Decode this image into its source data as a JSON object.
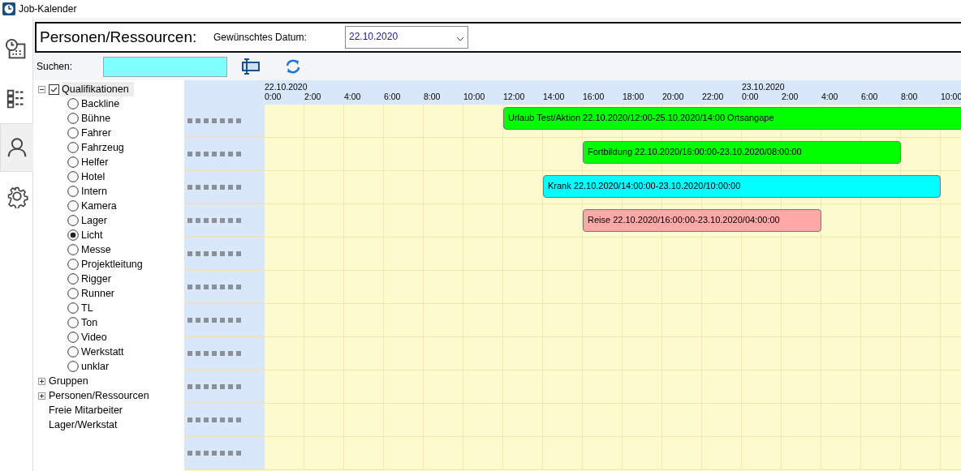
{
  "window": {
    "title": "Job-Kalender"
  },
  "sidebar": {
    "items": [
      {
        "kind": "calendar",
        "selected": false
      },
      {
        "kind": "list",
        "selected": false
      },
      {
        "kind": "person",
        "selected": true
      },
      {
        "kind": "settings",
        "selected": false
      }
    ]
  },
  "header": {
    "title": "Personen/Ressourcen:",
    "date_label": "Gewünschtes Datum:",
    "date_value": "22.10.2020"
  },
  "search": {
    "label": "Suchen:"
  },
  "tree": [
    {
      "label": "Qualifikationen",
      "kind": "checkbox",
      "checked": true,
      "expanded": true,
      "selected": true,
      "children": [
        {
          "label": "Backline",
          "selected": false
        },
        {
          "label": "Bühne",
          "selected": false
        },
        {
          "label": "Fahrer",
          "selected": false
        },
        {
          "label": "Fahrzeug",
          "selected": false
        },
        {
          "label": "Helfer",
          "selected": false
        },
        {
          "label": "Hotel",
          "selected": false
        },
        {
          "label": "Intern",
          "selected": false
        },
        {
          "label": "Kamera",
          "selected": false
        },
        {
          "label": "Lager",
          "selected": false
        },
        {
          "label": "Licht",
          "selected": true
        },
        {
          "label": "Messe",
          "selected": false
        },
        {
          "label": "Projektleitung",
          "selected": false
        },
        {
          "label": "Rigger",
          "selected": false
        },
        {
          "label": "Runner",
          "selected": false
        },
        {
          "label": "TL",
          "selected": false
        },
        {
          "label": "Ton",
          "selected": false
        },
        {
          "label": "Video",
          "selected": false
        },
        {
          "label": "Werkstatt",
          "selected": false
        },
        {
          "label": "unklar",
          "selected": false
        }
      ]
    },
    {
      "label": "Gruppen",
      "kind": "node",
      "expanded": false,
      "selected": false
    },
    {
      "label": "Personen/Ressourcen",
      "kind": "node",
      "expanded": false,
      "selected": false
    },
    {
      "label": "Freie Mitarbeiter",
      "kind": "leaf",
      "selected": false
    },
    {
      "label": "Lager/Werkstat",
      "kind": "leaf",
      "selected": false
    }
  ],
  "timeline": {
    "days": [
      "22.10.2020",
      "23.10.2020"
    ],
    "hours": [
      "0:00",
      "2:00",
      "4:00",
      "6:00",
      "8:00",
      "10:00",
      "12:00",
      "14:00",
      "16:00",
      "18:00",
      "20:00",
      "22:00",
      "0:00",
      "2:00",
      "4:00",
      "6:00",
      "8:00",
      "10:00"
    ],
    "rows": [
      {
        "name_redacted": true,
        "event": {
          "label": "Urlaub Test/Aktion 22.10.2020/12:00-25.10.2020/14:00 Ortsangape",
          "color": "#00ff00"
        }
      },
      {
        "name_redacted": true,
        "event": {
          "label": "Fortbildung  22.10.2020/16:00:00-23.10.2020/08:00:00",
          "color": "#00ff00"
        }
      },
      {
        "name_redacted": true,
        "event": {
          "label": "Krank  22.10.2020/14:00:00-23.10.2020/10:00:00",
          "color": "#00ffff"
        }
      },
      {
        "name_redacted": true,
        "event": {
          "label": "Reise  22.10.2020/16:00:00-23.10.2020/04:00:00",
          "color": "#ffa8a8"
        }
      },
      {
        "name_redacted": true
      },
      {
        "name_redacted": true
      },
      {
        "name_redacted": true
      },
      {
        "name_redacted": true
      },
      {
        "name_redacted": true
      },
      {
        "name_redacted": true
      },
      {
        "name_redacted": true
      }
    ]
  }
}
